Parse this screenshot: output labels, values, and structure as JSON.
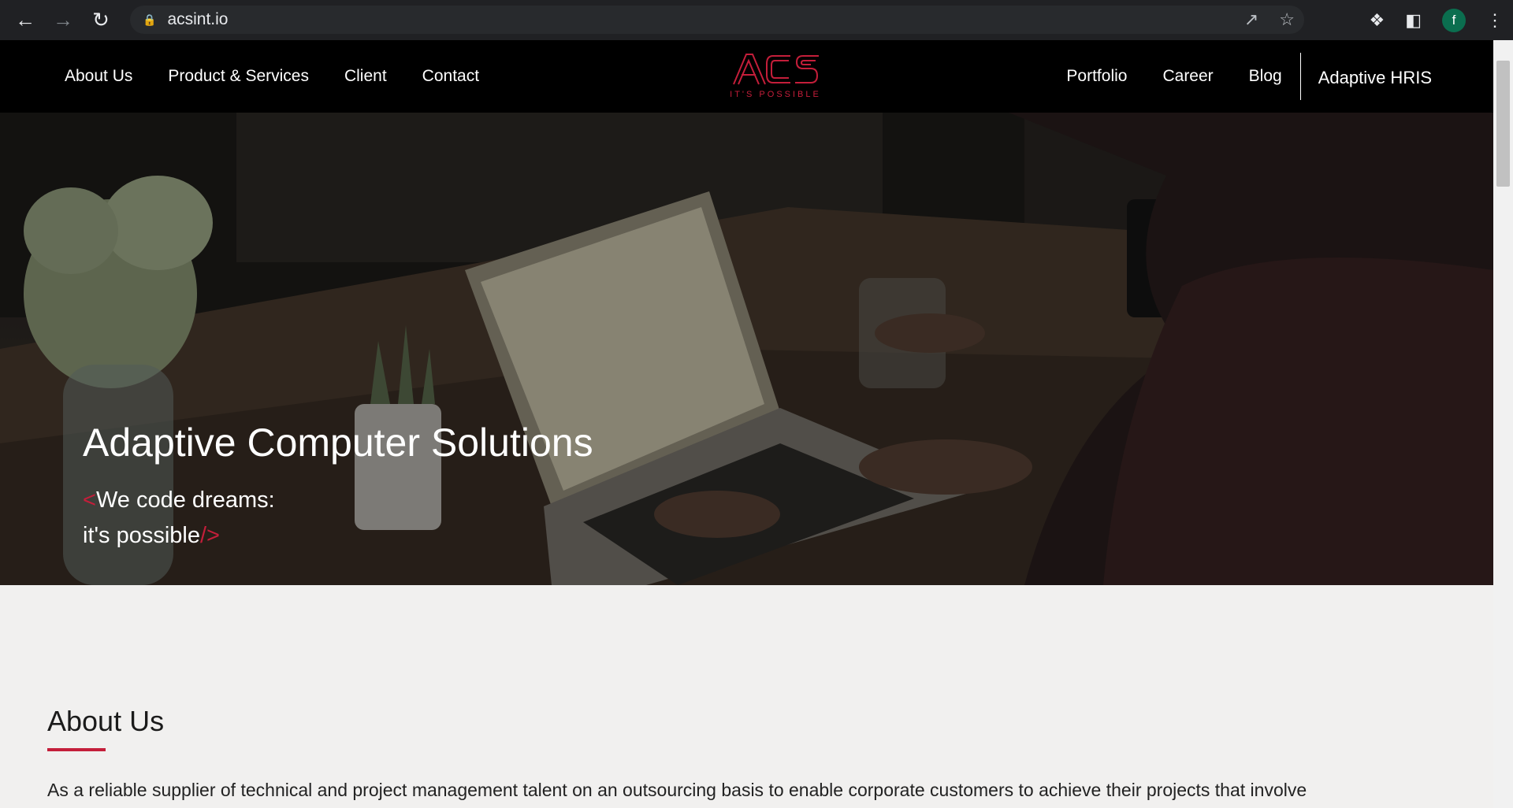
{
  "browser": {
    "url": "acsint.io",
    "profile_initial": "f",
    "icons": [
      "back-icon",
      "forward-icon",
      "reload-icon",
      "lock-icon",
      "share-icon",
      "star-icon",
      "extensions-icon",
      "side-panel-icon",
      "menu-icon"
    ]
  },
  "nav": {
    "left": [
      "About Us",
      "Product & Services",
      "Client",
      "Contact"
    ],
    "right": [
      "Portfolio",
      "Career",
      "Blog"
    ],
    "hris": "Adaptive HRIS"
  },
  "logo": {
    "text": "ACS",
    "tagline": "IT'S POSSIBLE",
    "color": "#c41e3a"
  },
  "hero": {
    "title": "Adaptive Computer Solutions",
    "line1_open": "<",
    "line1": "We code dreams:",
    "line2": "it's possible",
    "line2_close": "/>"
  },
  "about": {
    "title": "About Us",
    "text": "As a reliable supplier of technical and project management talent on an outsourcing basis to enable corporate customers to achieve their projects that involve"
  },
  "colors": {
    "accent": "#c41e3a",
    "header_bg": "#000000",
    "page_bg": "#f1f0ef"
  }
}
